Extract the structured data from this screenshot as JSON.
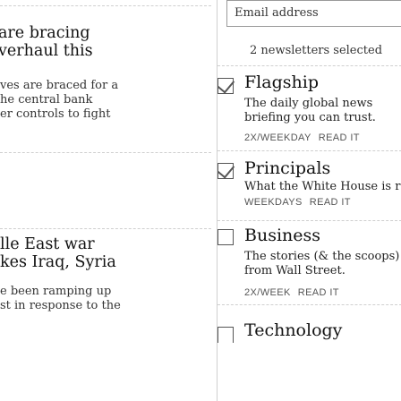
{
  "stories": [
    {
      "lines": [
        "are bracing",
        "verhaul this"
      ]
    },
    {
      "lines": [
        "ves are braced for a",
        "he central bank",
        "er controls to fight"
      ]
    },
    {
      "lines": [
        "lle East war",
        "kes Iraq, Syria"
      ]
    },
    {
      "lines": [
        "e been ramping up",
        "st in response to the"
      ]
    }
  ],
  "signup": {
    "email_placeholder": "Email address",
    "selected_status": "2 newsletters selected"
  },
  "newsletters": [
    {
      "name": "Flagship",
      "description": "The daily global news briefing you can trust.",
      "frequency": "2X/WEEKDAY",
      "read_label": "READ IT",
      "checked": true
    },
    {
      "name": "Principals",
      "description": "What the White House is reading.",
      "frequency": "WEEKDAYS",
      "read_label": "READ IT",
      "checked": true
    },
    {
      "name": "Business",
      "description": "The stories (& the scoops) from Wall Street.",
      "frequency": "2X/WEEK",
      "read_label": "READ IT",
      "checked": false
    },
    {
      "name": "Technology",
      "description": "",
      "frequency": "",
      "read_label": "",
      "checked": false
    }
  ]
}
